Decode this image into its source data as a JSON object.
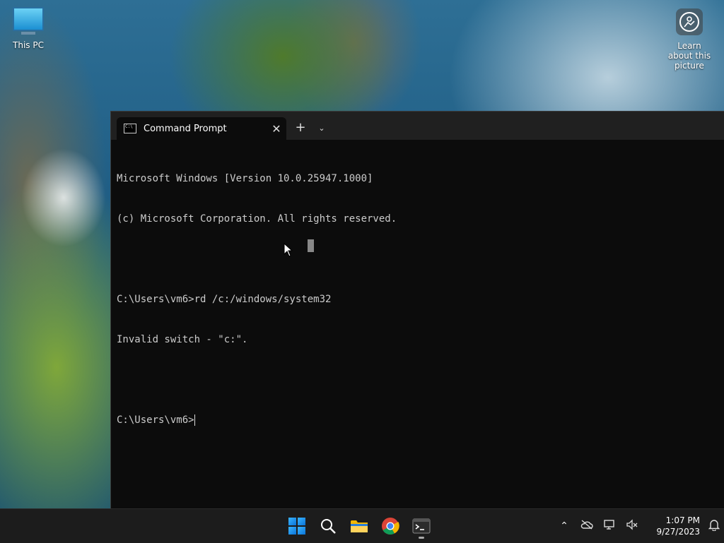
{
  "desktop": {
    "icons": [
      {
        "label": "This PC"
      },
      {
        "label": "Learn about this picture"
      }
    ]
  },
  "window": {
    "tab_title": "Command Prompt",
    "console_lines": [
      "Microsoft Windows [Version 10.0.25947.1000]",
      "(c) Microsoft Corporation. All rights reserved.",
      "",
      "C:\\Users\\vm6>rd /c:/windows/system32",
      "Invalid switch - \"c:\".",
      "",
      "C:\\Users\\vm6>"
    ]
  },
  "taskbar": {
    "apps": [
      "windows-start",
      "search",
      "file-explorer",
      "chrome",
      "terminal"
    ],
    "clock": {
      "time": "1:07 PM",
      "date": "9/27/2023"
    }
  },
  "colors": {
    "console_bg": "#0c0c0c",
    "console_text": "#cccccc",
    "titlebar": "#202020",
    "taskbar": "#1c1c1c"
  }
}
